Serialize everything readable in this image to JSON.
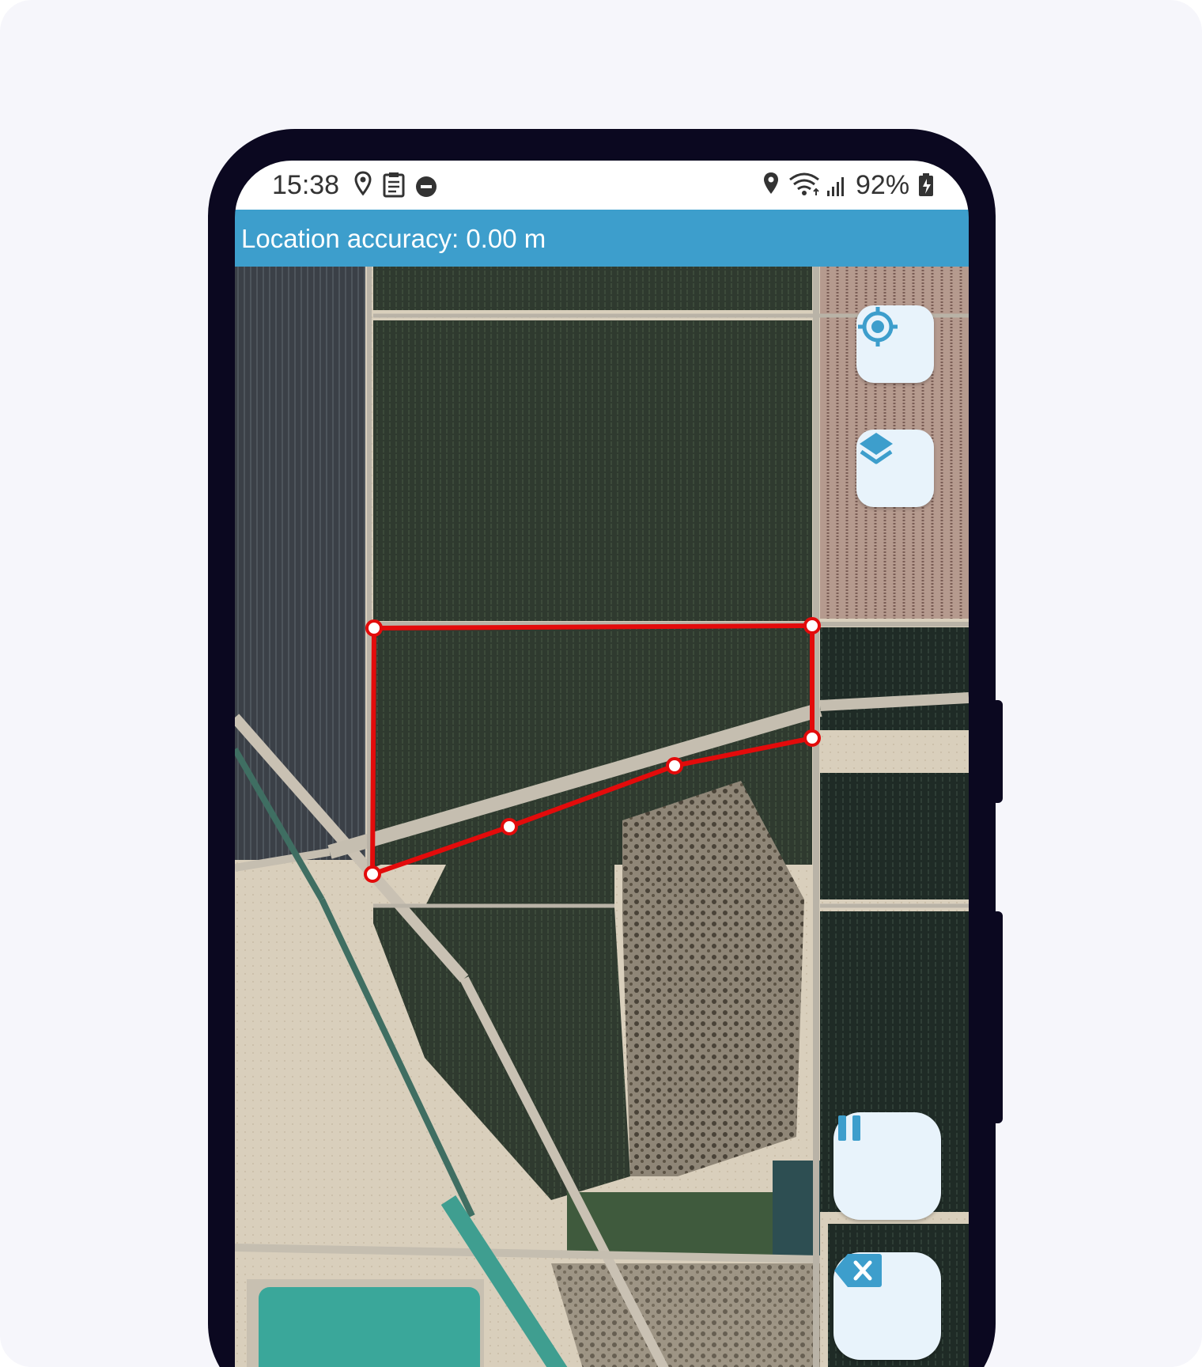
{
  "status_bar": {
    "time": "15:38",
    "left_icons": [
      "location-pin-icon",
      "clipboard-icon",
      "do-not-disturb-icon"
    ],
    "right_icons": [
      "location-pin-icon",
      "wifi-icon",
      "signal-icon",
      "battery-charging-icon"
    ],
    "battery": "92%"
  },
  "accuracy_banner": {
    "text": "Location accuracy: 0.00 m"
  },
  "map": {
    "type": "satellite",
    "polygon_color": "#e30b0b",
    "vertex_count": 6
  },
  "controls": {
    "locate_icon": "crosshair-icon",
    "layers_icon": "layers-icon",
    "pause_icon": "pause-icon",
    "delete_icon": "backspace-icon",
    "accent_color": "#3d9ecc"
  }
}
